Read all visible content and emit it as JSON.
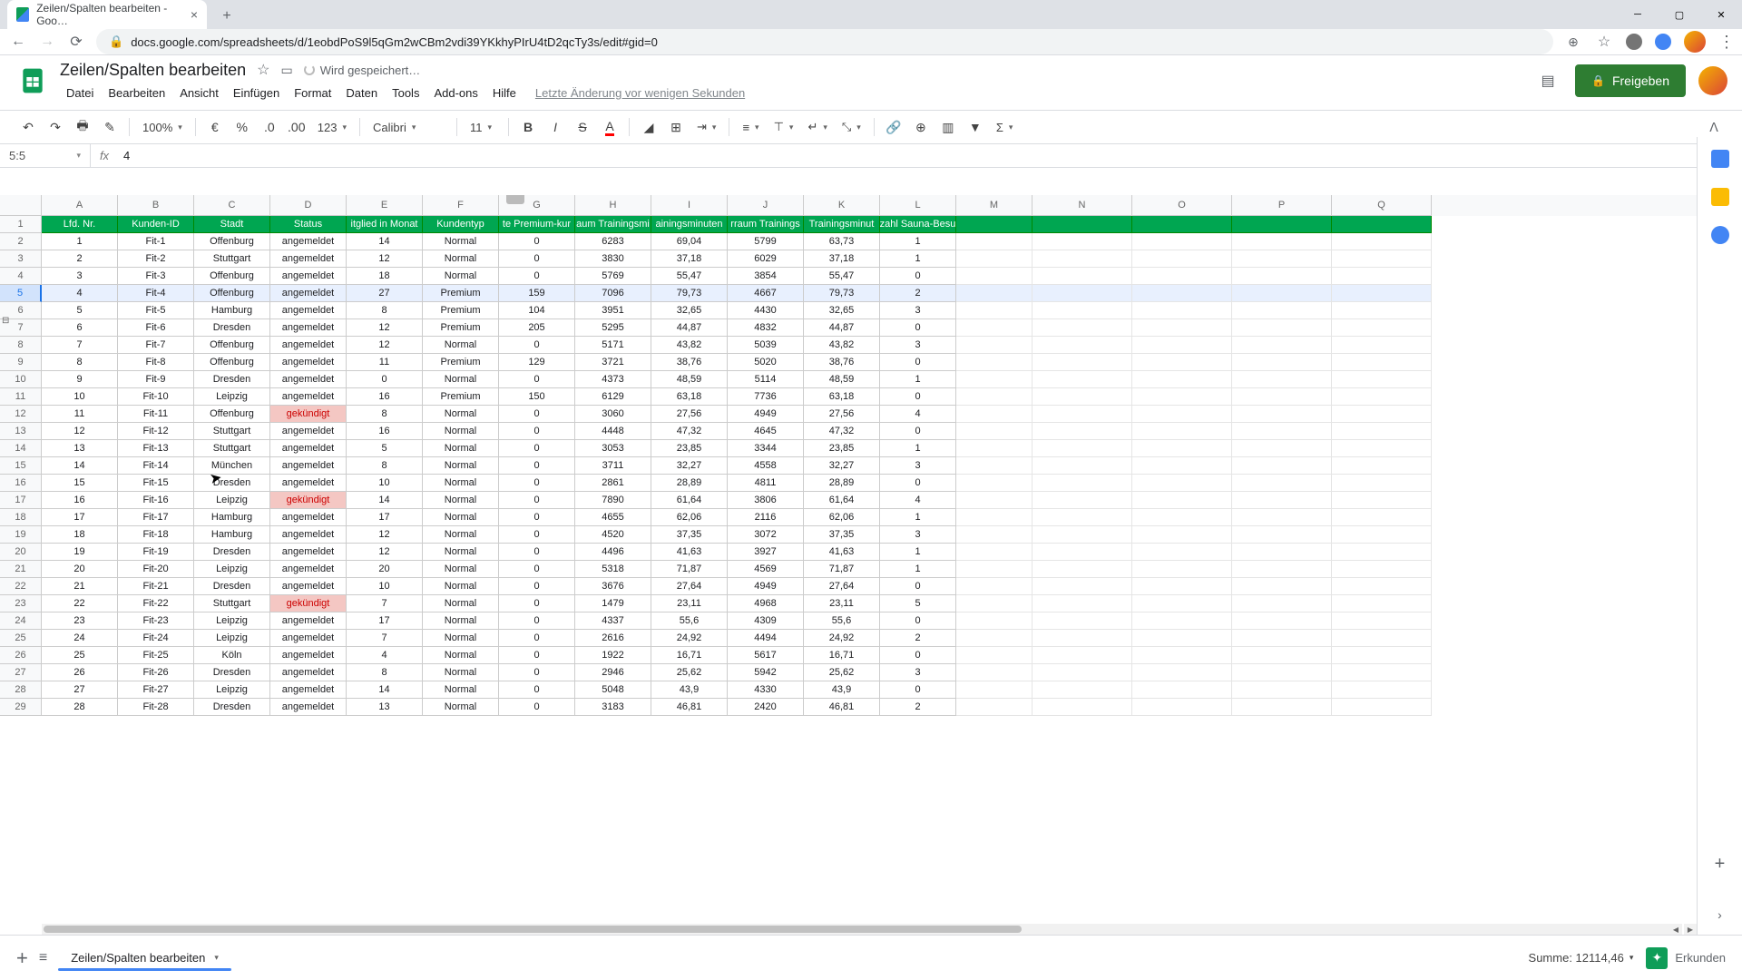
{
  "browser": {
    "tab_title": "Zeilen/Spalten bearbeiten - Goo…",
    "url": "docs.google.com/spreadsheets/d/1eobdPoS9l5qGm2wCBm2vdi39YKkhyPIrU4tD2qcTy3s/edit#gid=0"
  },
  "doc": {
    "title": "Zeilen/Spalten bearbeiten",
    "save_status": "Wird gespeichert…",
    "last_edit": "Letzte Änderung vor wenigen Sekunden"
  },
  "menus": [
    "Datei",
    "Bearbeiten",
    "Ansicht",
    "Einfügen",
    "Format",
    "Daten",
    "Tools",
    "Add-ons",
    "Hilfe"
  ],
  "toolbar": {
    "zoom": "100%",
    "font": "Calibri",
    "size": "11"
  },
  "namebox": "5:5",
  "formula": "4",
  "columns": [
    "A",
    "B",
    "C",
    "D",
    "E",
    "F",
    "G",
    "H",
    "I",
    "J",
    "K",
    "L",
    "M",
    "N",
    "O",
    "P",
    "Q"
  ],
  "headers": [
    "Lfd. Nr.",
    "Kunden-ID",
    "Stadt",
    "Status",
    "itglied in Monat",
    "Kundentyp",
    "te Premium-kur",
    "aum Trainingsmi",
    "ainingsminuten",
    "rraum Trainings",
    "Trainingsminut",
    "zahl Sauna-Besu"
  ],
  "selected_row": 5,
  "rows": [
    [
      1,
      "Fit-1",
      "Offenburg",
      "angemeldet",
      14,
      "Normal",
      0,
      6283,
      "69,04",
      5799,
      "63,73",
      1
    ],
    [
      2,
      "Fit-2",
      "Stuttgart",
      "angemeldet",
      12,
      "Normal",
      0,
      3830,
      "37,18",
      6029,
      "37,18",
      1
    ],
    [
      3,
      "Fit-3",
      "Offenburg",
      "angemeldet",
      18,
      "Normal",
      0,
      5769,
      "55,47",
      3854,
      "55,47",
      0
    ],
    [
      4,
      "Fit-4",
      "Offenburg",
      "angemeldet",
      27,
      "Premium",
      159,
      7096,
      "79,73",
      4667,
      "79,73",
      2
    ],
    [
      5,
      "Fit-5",
      "Hamburg",
      "angemeldet",
      8,
      "Premium",
      104,
      3951,
      "32,65",
      4430,
      "32,65",
      3
    ],
    [
      6,
      "Fit-6",
      "Dresden",
      "angemeldet",
      12,
      "Premium",
      205,
      5295,
      "44,87",
      4832,
      "44,87",
      0
    ],
    [
      7,
      "Fit-7",
      "Offenburg",
      "angemeldet",
      12,
      "Normal",
      0,
      5171,
      "43,82",
      5039,
      "43,82",
      3
    ],
    [
      8,
      "Fit-8",
      "Offenburg",
      "angemeldet",
      11,
      "Premium",
      129,
      3721,
      "38,76",
      5020,
      "38,76",
      0
    ],
    [
      9,
      "Fit-9",
      "Dresden",
      "angemeldet",
      0,
      "Normal",
      0,
      4373,
      "48,59",
      5114,
      "48,59",
      1
    ],
    [
      10,
      "Fit-10",
      "Leipzig",
      "angemeldet",
      16,
      "Premium",
      150,
      6129,
      "63,18",
      7736,
      "63,18",
      0
    ],
    [
      11,
      "Fit-11",
      "Offenburg",
      "gekündigt",
      8,
      "Normal",
      0,
      3060,
      "27,56",
      4949,
      "27,56",
      4
    ],
    [
      12,
      "Fit-12",
      "Stuttgart",
      "angemeldet",
      16,
      "Normal",
      0,
      4448,
      "47,32",
      4645,
      "47,32",
      0
    ],
    [
      13,
      "Fit-13",
      "Stuttgart",
      "angemeldet",
      5,
      "Normal",
      0,
      3053,
      "23,85",
      3344,
      "23,85",
      1
    ],
    [
      14,
      "Fit-14",
      "München",
      "angemeldet",
      8,
      "Normal",
      0,
      3711,
      "32,27",
      4558,
      "32,27",
      3
    ],
    [
      15,
      "Fit-15",
      "Dresden",
      "angemeldet",
      10,
      "Normal",
      0,
      2861,
      "28,89",
      4811,
      "28,89",
      0
    ],
    [
      16,
      "Fit-16",
      "Leipzig",
      "gekündigt",
      14,
      "Normal",
      0,
      7890,
      "61,64",
      3806,
      "61,64",
      4
    ],
    [
      17,
      "Fit-17",
      "Hamburg",
      "angemeldet",
      17,
      "Normal",
      0,
      4655,
      "62,06",
      2116,
      "62,06",
      1
    ],
    [
      18,
      "Fit-18",
      "Hamburg",
      "angemeldet",
      12,
      "Normal",
      0,
      4520,
      "37,35",
      3072,
      "37,35",
      3
    ],
    [
      19,
      "Fit-19",
      "Dresden",
      "angemeldet",
      12,
      "Normal",
      0,
      4496,
      "41,63",
      3927,
      "41,63",
      1
    ],
    [
      20,
      "Fit-20",
      "Leipzig",
      "angemeldet",
      20,
      "Normal",
      0,
      5318,
      "71,87",
      4569,
      "71,87",
      1
    ],
    [
      21,
      "Fit-21",
      "Dresden",
      "angemeldet",
      10,
      "Normal",
      0,
      3676,
      "27,64",
      4949,
      "27,64",
      0
    ],
    [
      22,
      "Fit-22",
      "Stuttgart",
      "gekündigt",
      7,
      "Normal",
      0,
      1479,
      "23,11",
      4968,
      "23,11",
      5
    ],
    [
      23,
      "Fit-23",
      "Leipzig",
      "angemeldet",
      17,
      "Normal",
      0,
      4337,
      "55,6",
      4309,
      "55,6",
      0
    ],
    [
      24,
      "Fit-24",
      "Leipzig",
      "angemeldet",
      7,
      "Normal",
      0,
      2616,
      "24,92",
      4494,
      "24,92",
      2
    ],
    [
      25,
      "Fit-25",
      "Köln",
      "angemeldet",
      4,
      "Normal",
      0,
      1922,
      "16,71",
      5617,
      "16,71",
      0
    ],
    [
      26,
      "Fit-26",
      "Dresden",
      "angemeldet",
      8,
      "Normal",
      0,
      2946,
      "25,62",
      5942,
      "25,62",
      3
    ],
    [
      27,
      "Fit-27",
      "Leipzig",
      "angemeldet",
      14,
      "Normal",
      0,
      5048,
      "43,9",
      4330,
      "43,9",
      0
    ],
    [
      28,
      "Fit-28",
      "Dresden",
      "angemeldet",
      13,
      "Normal",
      0,
      3183,
      "46,81",
      2420,
      "46,81",
      2
    ]
  ],
  "sheet_tab": "Zeilen/Spalten bearbeiten",
  "summary": "Summe: 12114,46",
  "explore": "Erkunden",
  "share": "Freigeben"
}
